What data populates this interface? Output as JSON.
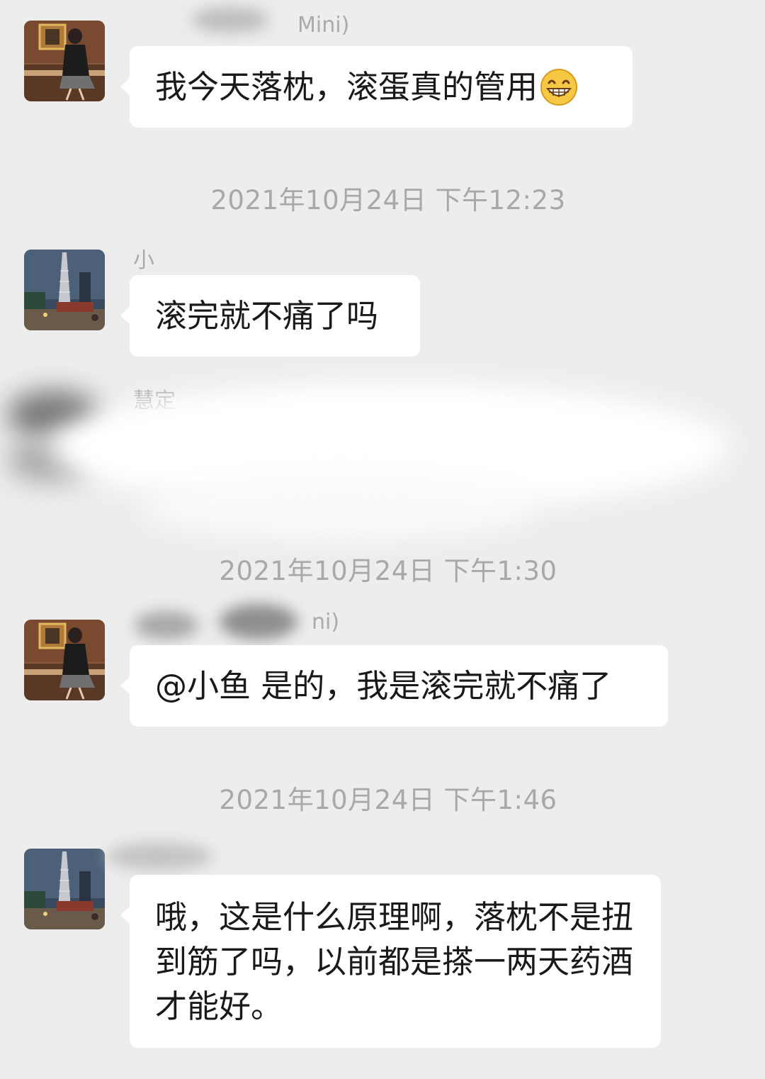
{
  "messages": [
    {
      "sender_visible": "Mini)",
      "avatar": "woman-portrait-avatar",
      "text": "我今天落枕，滚蛋真的管用",
      "emoji": "grinning-face-emoji"
    },
    {
      "sender_visible": "小",
      "avatar": "city-tower-night-avatar",
      "text": "滚完就不痛了吗"
    },
    {
      "sender_visible": "慧定",
      "avatar": "redacted-avatar",
      "text": "",
      "redacted": true
    },
    {
      "sender_visible": "ni)",
      "avatar": "woman-portrait-avatar",
      "text": "@小鱼 是的，我是滚完就不痛了"
    },
    {
      "sender_visible": "",
      "avatar": "city-tower-night-avatar",
      "text": "哦，这是什么原理啊，落枕不是扭到筋了吗，以前都是搽一两天药酒才能好。"
    }
  ],
  "timestamps": [
    "2021年10月24日 下午12:23",
    "2021年10月24日 下午1:30",
    "2021年10月24日 下午1:46"
  ],
  "colors": {
    "background": "#ededed",
    "bubble": "#ffffff",
    "text": "#191919",
    "meta": "#a8a8a8"
  }
}
